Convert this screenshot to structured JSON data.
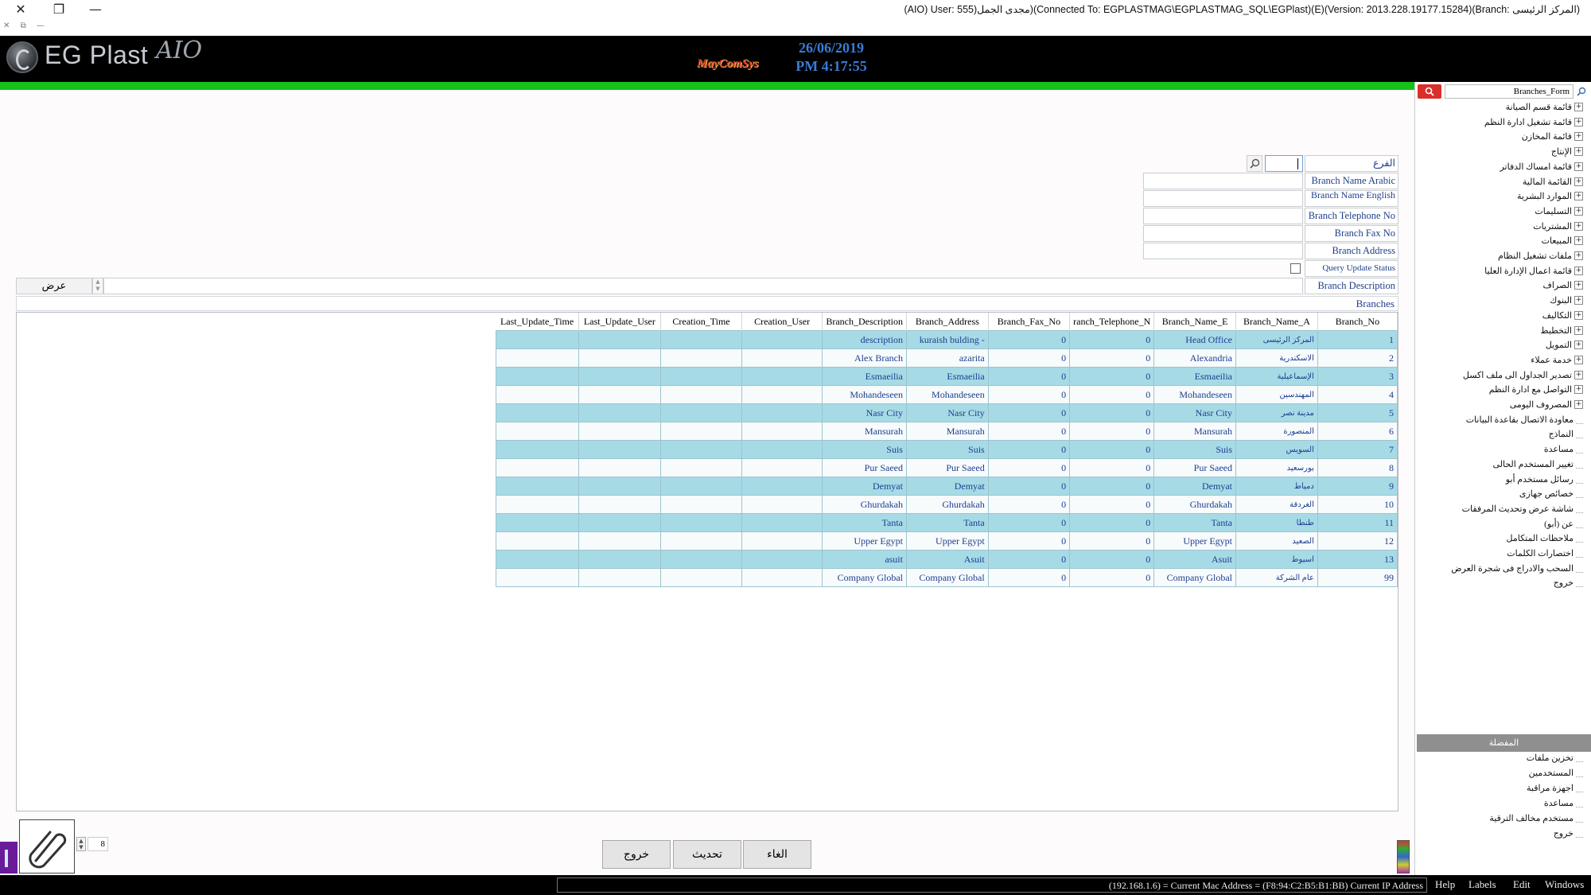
{
  "window": {
    "title": "(AIO) User: 555)مجدى الجمل)(Connected To: EGPLASTMAG\\EGPLASTMAG_SQL\\EGPlast)(E)(Version: 2013.228.19177.15284)(Branch: المركز الرئيسى)",
    "controls": [
      "✕",
      "❐",
      "—"
    ],
    "mini_controls": [
      "✕",
      "⧉",
      "—"
    ]
  },
  "header": {
    "logo_text": "EG Plast",
    "logo_suffix": "AIO",
    "brand": "MayComSys",
    "date": "26/06/2019",
    "time": "PM 4:17:55"
  },
  "form": {
    "search_label": "الفرع",
    "search_value": "",
    "fields": [
      {
        "label": "Branch Name Arabic",
        "value": ""
      },
      {
        "label": "Branch Name English",
        "value": ""
      },
      {
        "label": "Branch Telephone No",
        "value": ""
      },
      {
        "label": "Branch Fax No",
        "value": ""
      },
      {
        "label": "Branch Address",
        "value": ""
      }
    ],
    "query_update_status": "Query Update Status",
    "branch_description_label": "Branch Description",
    "show_button": "عرض",
    "section_title": "Branches"
  },
  "grid": {
    "columns": [
      "Branch_No",
      "Branch_Name_A",
      "Branch_Name_E",
      "ranch_Telephone_N",
      "Branch_Fax_No",
      "Branch_Address",
      "Branch_Description",
      "Creation_User",
      "Creation_Time",
      "Last_Update_User",
      "Last_Update_Time"
    ],
    "rows": [
      [
        "1",
        "المركز الرئيسى",
        "Head Office",
        "0",
        "0",
        "kuraish bulding -",
        "description",
        "",
        "",
        "",
        ""
      ],
      [
        "2",
        "الاسكندرية",
        "Alexandria",
        "0",
        "0",
        "azarita",
        "Alex Branch",
        "",
        "",
        "",
        ""
      ],
      [
        "3",
        "الإسماعيلية",
        "Esmaeilia",
        "0",
        "0",
        "Esmaeilia",
        "Esmaeilia",
        "",
        "",
        "",
        ""
      ],
      [
        "4",
        "المهندسين",
        "Mohandeseen",
        "0",
        "0",
        "Mohandeseen",
        "Mohandeseen",
        "",
        "",
        "",
        ""
      ],
      [
        "5",
        "مدينة نصر",
        "Nasr City",
        "0",
        "0",
        "Nasr City",
        "Nasr City",
        "",
        "",
        "",
        ""
      ],
      [
        "6",
        "المنصورة",
        "Mansurah",
        "0",
        "0",
        "Mansurah",
        "Mansurah",
        "",
        "",
        "",
        ""
      ],
      [
        "7",
        "السويس",
        "Suis",
        "0",
        "0",
        "Suis",
        "Suis",
        "",
        "",
        "",
        ""
      ],
      [
        "8",
        "بورسعيد",
        "Pur Saeed",
        "0",
        "0",
        "Pur Saeed",
        "Pur Saeed",
        "",
        "",
        "",
        ""
      ],
      [
        "9",
        "دمياط",
        "Demyat",
        "0",
        "0",
        "Demyat",
        "Demyat",
        "",
        "",
        "",
        ""
      ],
      [
        "10",
        "الغردقة",
        "Ghurdakah",
        "0",
        "0",
        "Ghurdakah",
        "Ghurdakah",
        "",
        "",
        "",
        ""
      ],
      [
        "11",
        "طنطا",
        "Tanta",
        "0",
        "0",
        "Tanta",
        "Tanta",
        "",
        "",
        "",
        ""
      ],
      [
        "12",
        "الصعيد",
        "Upper Egypt",
        "0",
        "0",
        "Upper Egypt",
        "Upper Egypt",
        "",
        "",
        "",
        ""
      ],
      [
        "13",
        "اسيوط",
        "Asuit",
        "0",
        "0",
        "Asuit",
        "asuit",
        "",
        "",
        "",
        ""
      ],
      [
        "99",
        "عام الشركة",
        "Company Global",
        "0",
        "0",
        "Company Global",
        "Company Global",
        "",
        "",
        "",
        ""
      ]
    ]
  },
  "bottom": {
    "buttons": {
      "exit": "خروج",
      "refresh": "تحديث",
      "cancel": "الغاء"
    },
    "page_value": "8"
  },
  "status": {
    "ip_text": "(192.168.1.6) = Current Mac Address = (F8:94:C2:B5:B1:BB) Current IP Address",
    "menu": [
      "Help",
      "Labels",
      "Edit",
      "Windows"
    ]
  },
  "sidebar": {
    "search_value": "Branches_Form",
    "tree": [
      {
        "label": "قائمة قسم الصيانة",
        "expandable": true
      },
      {
        "label": "قائمة تشغيل ادارة النظم",
        "expandable": true
      },
      {
        "label": "قائمة المخازن",
        "expandable": true
      },
      {
        "label": "الإنتاج",
        "expandable": true
      },
      {
        "label": "قائمة امساك الدفاتر",
        "expandable": true
      },
      {
        "label": "القائمة المالية",
        "expandable": true
      },
      {
        "label": "الموارد البشرية",
        "expandable": true
      },
      {
        "label": "التسليمات",
        "expandable": true
      },
      {
        "label": "المشتريات",
        "expandable": true
      },
      {
        "label": "المبيعات",
        "expandable": true
      },
      {
        "label": "ملفات تشغيل النظام",
        "expandable": true
      },
      {
        "label": "قائمة اعمال الإدارة العليا",
        "expandable": true
      },
      {
        "label": "الصراف",
        "expandable": true
      },
      {
        "label": "البنوك",
        "expandable": true
      },
      {
        "label": "التكاليف",
        "expandable": true
      },
      {
        "label": "التخطيط",
        "expandable": true
      },
      {
        "label": "التمويل",
        "expandable": true
      },
      {
        "label": "خدمة عملاء",
        "expandable": true
      },
      {
        "label": "تصدير الجداول الى ملف اكسل",
        "expandable": true
      },
      {
        "label": "التواصل مع ادارة النظم",
        "expandable": true
      },
      {
        "label": "المصروف اليومى",
        "expandable": true
      },
      {
        "label": "معاودة الاتصال بقاعدة البيانات",
        "expandable": false
      },
      {
        "label": "النماذج",
        "expandable": false
      },
      {
        "label": "مساعدة",
        "expandable": false
      },
      {
        "label": "تغيير المستخدم الحالى",
        "expandable": false
      },
      {
        "label": "رسائل مستخدم أبو",
        "expandable": false
      },
      {
        "label": "خصائص جهازى",
        "expandable": false
      },
      {
        "label": "شاشة عرض وتحديث المرفقات",
        "expandable": false
      },
      {
        "label": "عن (أبو)",
        "expandable": false
      },
      {
        "label": "ملاحظات المتكامل",
        "expandable": false
      },
      {
        "label": "اختصارات الكلمات",
        "expandable": false
      },
      {
        "label": "السحب والادراج فى شجرة العرض",
        "expandable": false
      },
      {
        "label": "خروج",
        "expandable": false
      }
    ],
    "shortcuts_header": "المفضلة",
    "shortcuts": [
      "تخزين ملفات",
      "المستخدمين",
      "اجهزة مراقبة",
      "مساعدة",
      "مستخدم مخالف الترقية",
      "خروج"
    ]
  },
  "colors": {
    "green_bar": "#15c21b",
    "header_bg": "#000000",
    "row_highlight": "#a6dbe6",
    "label_text": "#1e3f8a",
    "search_button": "#d9302c"
  }
}
